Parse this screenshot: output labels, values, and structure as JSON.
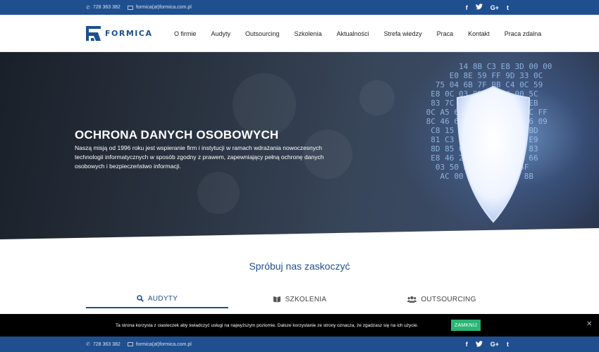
{
  "topbar": {
    "phone": "728 363 382",
    "email": "formica(at)formica.com.pl",
    "social": [
      "f",
      "t",
      "G+",
      "t"
    ]
  },
  "brand": {
    "name": "FORMICA",
    "color": "#1f4f8f"
  },
  "menu": [
    "O firmie",
    "Audyty",
    "Outsourcing",
    "Szkolenia",
    "Aktualności",
    "Strefa wiedzy",
    "Praca",
    "Kontakt",
    "Praca zdalna"
  ],
  "hero": {
    "title": "OCHRONA DANYCH OSOBOWYCH",
    "text": "Naszą misją od 1996 roku jest wspieranie firm i instytucji w ramach wdrażania nowoczesnych technologii informatycznych w sposób zgodny z prawem, zapewniający pełną ochronę danych osobowych i bezpieczeństwo informacji."
  },
  "section": {
    "title": "Spróbuj nas zaskoczyć"
  },
  "tabs": [
    {
      "label": "AUDYTY",
      "icon": "search-icon",
      "active": true
    },
    {
      "label": "SZKOLENIA",
      "icon": "book-icon",
      "active": false
    },
    {
      "label": "OUTSOURCING",
      "icon": "users-icon",
      "active": false
    }
  ],
  "cookie": {
    "message": "Ta strona korzysta z ciasteczek aby świadczyć usługi na najwyższym poziomie. Dalsze korzystanie ze strony oznacza, że zgadzasz się na ich użycie.",
    "button": "ZAMKNIJ",
    "button_color": "#2bb673"
  },
  "bottombar": {
    "phone": "728 363 382",
    "email": "formica(at)formica.com.pl"
  }
}
